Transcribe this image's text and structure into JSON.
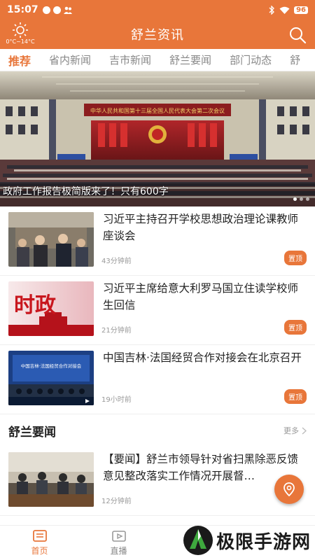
{
  "status_bar": {
    "time": "15:07",
    "battery": "96"
  },
  "header": {
    "title": "舒兰资讯",
    "weather_temp": "0°C~14°C"
  },
  "tabs": [
    {
      "label": "推荐",
      "active": true
    },
    {
      "label": "省内新闻"
    },
    {
      "label": "吉市新闻"
    },
    {
      "label": "舒兰要闻"
    },
    {
      "label": "部门动态"
    },
    {
      "label": "舒"
    }
  ],
  "banner": {
    "hall_text": "中华人民共和国第十三届全国人民代表大会第二次会议",
    "caption": "政府工作报告极简版来了！只有600字"
  },
  "top_news": [
    {
      "title": "习近平主持召开学校思想政治理论课教师座谈会",
      "time": "43分钟前",
      "badge": "置顶"
    },
    {
      "title": "习近平主席给意大利罗马国立住读学校师生回信",
      "time": "21分钟前",
      "badge": "置顶",
      "thumb_text": "时政"
    },
    {
      "title": "中国吉林·法国经贸合作对接会在北京召开",
      "time": "19小时前",
      "badge": "置顶",
      "thumb_text": "中国吉林·法国经贸合作对接会"
    }
  ],
  "section": {
    "title": "舒兰要闻",
    "more": "更多"
  },
  "section_news": [
    {
      "title": "【要闻】舒兰市领导针对省扫黑除恶反馈意见整改落实工作情况开展督…",
      "time": "12分钟前"
    }
  ],
  "bottom_nav": [
    {
      "label": "首页",
      "active": true
    },
    {
      "label": "直播"
    }
  ],
  "watermark": "极限手游网",
  "colors": {
    "accent": "#e8763a"
  }
}
